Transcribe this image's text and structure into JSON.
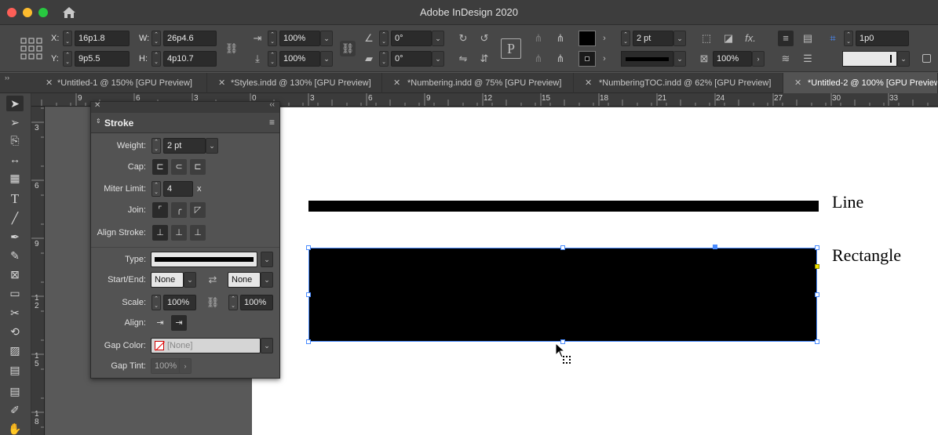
{
  "app": {
    "title": "Adobe InDesign 2020"
  },
  "control_bar": {
    "x_label": "X:",
    "x_value": "16p1.8",
    "y_label": "Y:",
    "y_value": "9p5.5",
    "w_label": "W:",
    "w_value": "26p4.6",
    "h_label": "H:",
    "h_value": "4p10.7",
    "scale_x": "100%",
    "scale_y": "100%",
    "rotate": "0°",
    "shear": "0°",
    "stroke_weight": "2 pt",
    "opacity": "100%",
    "corner_size": "1p0"
  },
  "tabs": [
    {
      "label": "*Untitled-1 @ 150% [GPU Preview]",
      "active": false
    },
    {
      "label": "*Styles.indd @ 130% [GPU Preview]",
      "active": false
    },
    {
      "label": "*Numbering.indd @ 75% [GPU Preview]",
      "active": false
    },
    {
      "label": "*NumberingTOC.indd @ 62% [GPU Preview]",
      "active": false
    },
    {
      "label": "*Untitled-2 @ 100% [GPU Preview]",
      "active": true
    }
  ],
  "rulers": {
    "horizontal": [
      "9",
      "6",
      "3",
      "0",
      "3",
      "6",
      "9",
      "12",
      "15",
      "18",
      "21",
      "24",
      "27",
      "30",
      "33"
    ],
    "vertical": [
      "3",
      "6",
      "9",
      "1\n2",
      "1\n5",
      "1\n8"
    ]
  },
  "stroke_panel": {
    "title": "Stroke",
    "weight_label": "Weight:",
    "weight_value": "2 pt",
    "cap_label": "Cap:",
    "miter_label": "Miter Limit:",
    "miter_value": "4",
    "miter_unit": "x",
    "join_label": "Join:",
    "align_stroke_label": "Align Stroke:",
    "type_label": "Type:",
    "start_end_label": "Start/End:",
    "start_value": "None",
    "end_value": "None",
    "scale_label": "Scale:",
    "scale_start": "100%",
    "scale_end": "100%",
    "align_label": "Align:",
    "gap_color_label": "Gap Color:",
    "gap_color_value": "[None]",
    "gap_tint_label": "Gap Tint:",
    "gap_tint_value": "100%"
  },
  "canvas": {
    "line_label": "Line",
    "rect_label": "Rectangle"
  }
}
